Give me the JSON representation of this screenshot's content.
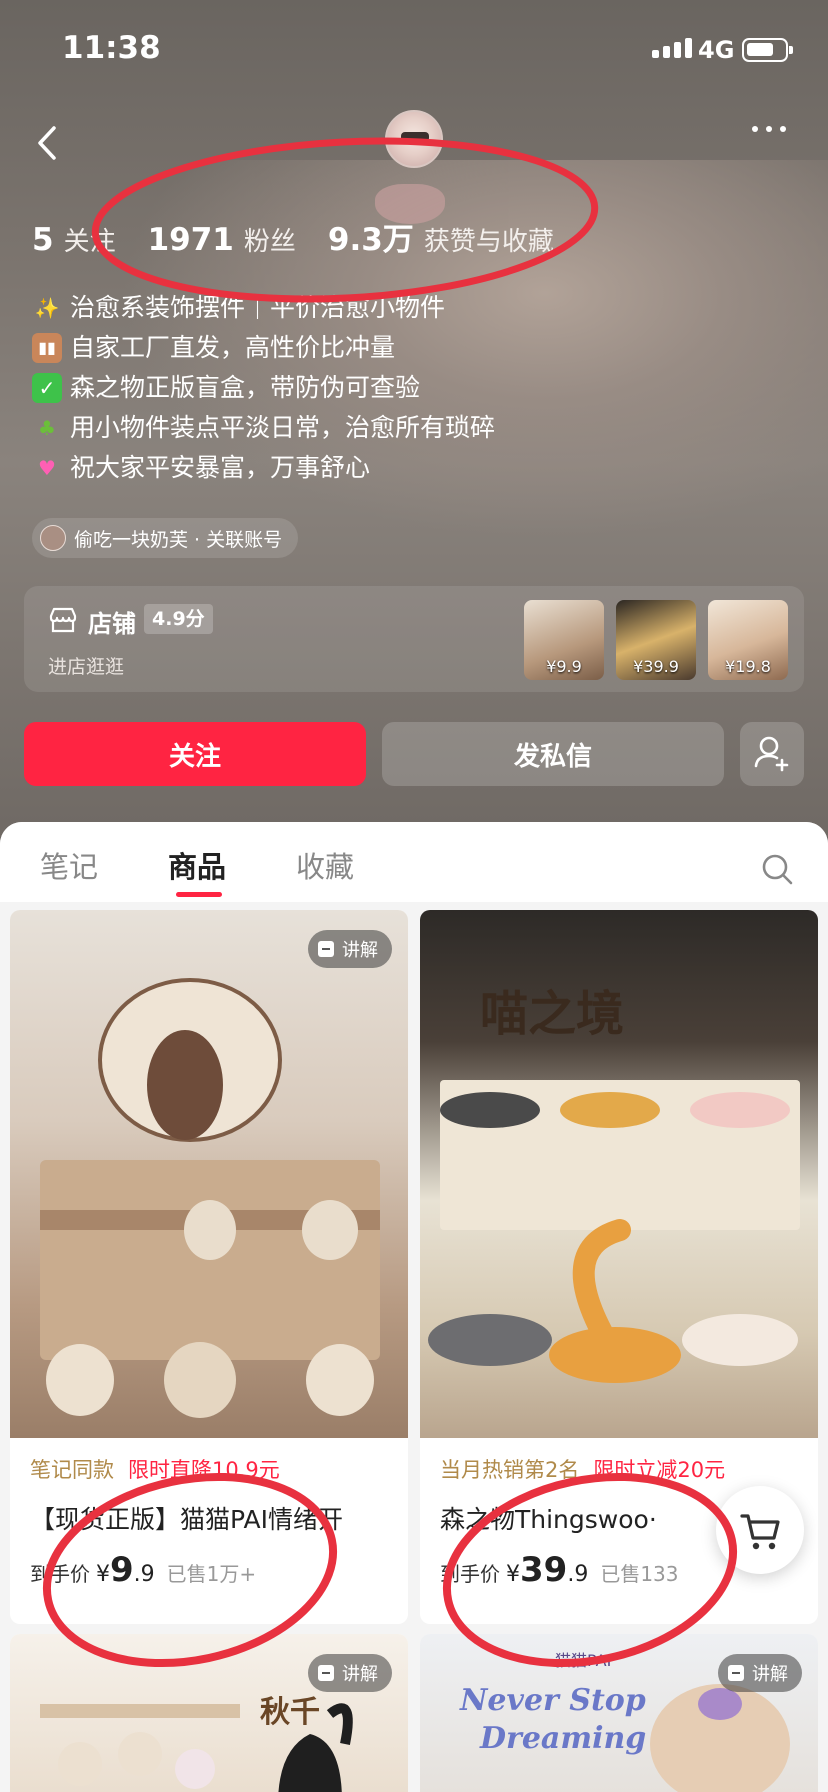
{
  "status_bar": {
    "time": "11:38",
    "network": "4G"
  },
  "profile": {
    "stats": [
      {
        "num": "5",
        "label": "关注"
      },
      {
        "num": "1971",
        "label": "粉丝"
      },
      {
        "num": "9.3万",
        "label": "获赞与收藏"
      }
    ],
    "bio": [
      {
        "emoji": "sparkles-icon",
        "text": "治愈系装饰摆件｜平价治愈小物件"
      },
      {
        "emoji": "factory-icon",
        "text": "自家工厂直发，高性价比冲量"
      },
      {
        "emoji": "check-mark-icon",
        "text": "森之物正版盲盒，带防伪可查验"
      },
      {
        "emoji": "potted-plant-icon",
        "text": "用小物件装点平淡日常，治愈所有琐碎"
      },
      {
        "emoji": "sparkling-heart-icon",
        "text": "祝大家平安暴富，万事舒心"
      }
    ],
    "linked_account": "偷吃一块奶芙 · 关联账号"
  },
  "shop": {
    "title": "店铺",
    "score": "4.9分",
    "subtitle": "进店逛逛",
    "thumbs": [
      {
        "price": "¥9.9"
      },
      {
        "price": "¥39.9"
      },
      {
        "price": "¥19.8"
      }
    ]
  },
  "actions": {
    "follow": "关注",
    "message": "发私信"
  },
  "tabs": [
    {
      "label": "笔记"
    },
    {
      "label": "商品"
    },
    {
      "label": "收藏"
    }
  ],
  "products": [
    {
      "badge": "讲解",
      "tag": "笔记同款",
      "promo": "限时直降10.9元",
      "title": "【现货正版】猫猫PAI情绪开",
      "price_label": "到手价",
      "price_yen": "¥",
      "price_int": "9",
      "price_dec": ".9",
      "sold": "已售1万+"
    },
    {
      "badge": "",
      "tag": "当月热销第2名",
      "promo": "限时立减20元",
      "title": "森之物Thingswoo·",
      "price_label": "到手价",
      "price_yen": "¥",
      "price_int": "39",
      "price_dec": ".9",
      "sold": "已售133"
    },
    {
      "badge": "讲解"
    },
    {
      "badge": "讲解"
    }
  ],
  "colors": {
    "brand_red": "#ff2442",
    "tag_gold": "#b08a4a",
    "annotation_red": "#e8313f"
  }
}
